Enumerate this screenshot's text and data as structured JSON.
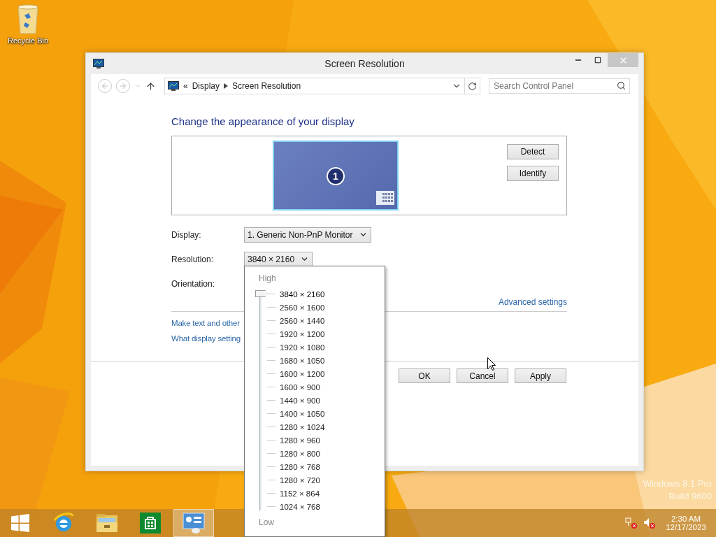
{
  "desktop": {
    "icons": [
      {
        "label": "Recycle Bin"
      }
    ],
    "watermark": [
      "Windows 8.1 Pro",
      "Build 9600"
    ]
  },
  "window": {
    "title": "Screen Resolution",
    "address": {
      "overflow": "«",
      "crumbs": [
        "Display",
        "Screen Resolution"
      ]
    },
    "search": {
      "placeholder": "Search Control Panel"
    },
    "heading": "Change the appearance of your display",
    "preview": {
      "monitors": [
        {
          "number": "1",
          "selected": true
        }
      ],
      "buttons": [
        "Detect",
        "Identify"
      ]
    },
    "fields": [
      {
        "label": "Display:",
        "value": "1. Generic Non-PnP Monitor"
      },
      {
        "label": "Resolution:",
        "value": "3840 × 2160"
      },
      {
        "label": "Orientation:"
      }
    ],
    "advanced_link": "Advanced settings",
    "links": [
      "Make text and other",
      "What display setting"
    ],
    "buttons": [
      "OK",
      "Cancel",
      "Apply"
    ]
  },
  "resolution_popup": {
    "high_label": "High",
    "low_label": "Low",
    "level": 1,
    "options": [
      {
        "label": "3840 × 2160",
        "selected": true
      },
      {
        "label": "2560 × 1600",
        "selected": false
      },
      {
        "label": "2560 × 1440",
        "selected": false
      },
      {
        "label": "1920 × 1200",
        "selected": false
      },
      {
        "label": "1920 × 1080",
        "selected": false
      },
      {
        "label": "1680 × 1050",
        "selected": false
      },
      {
        "label": "1600 × 1200",
        "selected": false
      },
      {
        "label": "1600 × 900",
        "selected": false
      },
      {
        "label": "1440 × 900",
        "selected": false
      },
      {
        "label": "1400 × 1050",
        "selected": false
      },
      {
        "label": "1280 × 1024",
        "selected": false
      },
      {
        "label": "1280 × 960",
        "selected": false
      },
      {
        "label": "1280 × 800",
        "selected": false
      },
      {
        "label": "1280 × 768",
        "selected": false
      },
      {
        "label": "1280 × 720",
        "selected": false
      },
      {
        "label": "1152 × 864",
        "selected": false
      },
      {
        "label": "1024 × 768",
        "selected": false
      }
    ]
  },
  "taskbar": {
    "apps": [
      {
        "kind": "start",
        "selected": false
      },
      {
        "kind": "browser",
        "selected": false
      },
      {
        "kind": "files",
        "selected": false
      },
      {
        "kind": "store",
        "selected": false
      },
      {
        "kind": "control",
        "selected": true
      }
    ],
    "clock": {
      "time": "2:30 AM",
      "date": "12/17/2023"
    }
  }
}
